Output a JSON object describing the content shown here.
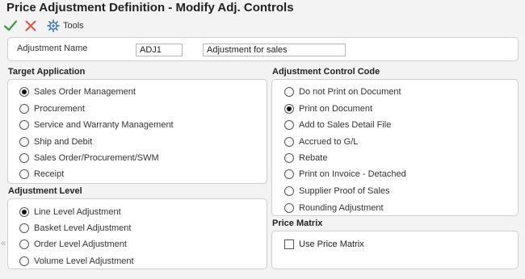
{
  "window": {
    "title": "Price Adjustment Definition - Modify Adj. Controls"
  },
  "toolbar": {
    "ok_icon": "checkmark-icon",
    "cancel_icon": "close-icon",
    "tools_icon": "gear-icon",
    "tools_label": "Tools",
    "ok_color": "#3c9a3c",
    "cancel_color": "#d9534f"
  },
  "header": {
    "adjustment_name_label": "Adjustment Name",
    "adjustment_code": "ADJ1",
    "adjustment_description": "Adjustment for sales"
  },
  "target_application": {
    "label": "Target Application",
    "selected": "Sales Order Management",
    "options": [
      "Sales Order Management",
      "Procurement",
      "Service and Warranty Management",
      "Ship and Debit",
      "Sales Order/Procurement/SWM",
      "Receipt"
    ]
  },
  "adjustment_level": {
    "label": "Adjustment Level",
    "selected": "Line Level Adjustment",
    "options": [
      "Line Level Adjustment",
      "Basket Level Adjustment",
      "Order Level Adjustment",
      "Volume Level Adjustment"
    ]
  },
  "adjustment_control_code": {
    "label": "Adjustment Control Code",
    "selected": "Print on Document",
    "options": [
      "Do not Print on Document",
      "Print on Document",
      "Add to Sales Detail File",
      "Accrued to G/L",
      "Rebate",
      "Print on Invoice - Detached",
      "Supplier Proof of Sales",
      "Rounding Adjustment"
    ]
  },
  "price_matrix": {
    "label": "Price Matrix",
    "use_price_matrix_label": "Use Price Matrix",
    "use_price_matrix_checked": false
  },
  "collapse_glyph": "«"
}
